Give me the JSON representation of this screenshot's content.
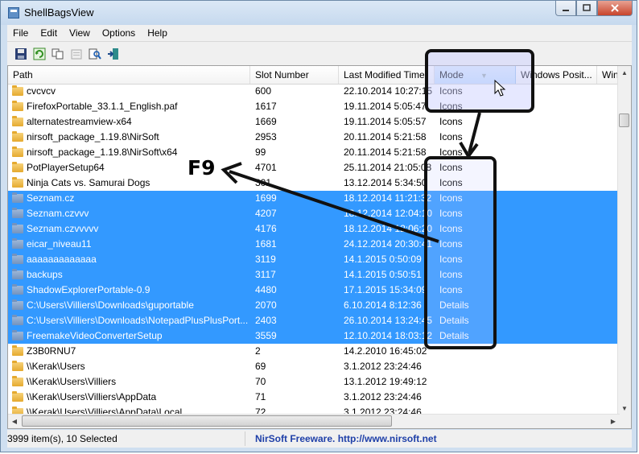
{
  "window": {
    "title": "ShellBagsView"
  },
  "menu": [
    "File",
    "Edit",
    "View",
    "Options",
    "Help"
  ],
  "toolbar": [
    {
      "icon": "save-icon"
    },
    {
      "icon": "refresh-icon"
    },
    {
      "icon": "copy-icon"
    },
    {
      "icon": "properties-icon"
    },
    {
      "icon": "find-icon"
    },
    {
      "icon": "exit-icon"
    }
  ],
  "columns": {
    "path": "Path",
    "slot": "Slot Number",
    "modified": "Last Modified Time",
    "mode": "Mode",
    "winpos": "Windows Posit...",
    "winsize": "Wind"
  },
  "rows": [
    {
      "path": "cvcvcv",
      "slot": "600",
      "time": "22.10.2014 10:27:15",
      "mode": "Icons",
      "sel": false
    },
    {
      "path": "FirefoxPortable_33.1.1_English.paf",
      "slot": "1617",
      "time": "19.11.2014 5:05:47",
      "mode": "Icons",
      "sel": false
    },
    {
      "path": "alternatestreamview-x64",
      "slot": "1669",
      "time": "19.11.2014 5:05:57",
      "mode": "Icons",
      "sel": false
    },
    {
      "path": "nirsoft_package_1.19.8\\NirSoft",
      "slot": "2953",
      "time": "20.11.2014 5:21:58",
      "mode": "Icons",
      "sel": false
    },
    {
      "path": "nirsoft_package_1.19.8\\NirSoft\\x64",
      "slot": "99",
      "time": "20.11.2014 5:21:58",
      "mode": "Icons",
      "sel": false
    },
    {
      "path": "PotPlayerSetup64",
      "slot": "4701",
      "time": "25.11.2014 21:05:08",
      "mode": "Icons",
      "sel": false
    },
    {
      "path": "Ninja Cats vs. Samurai Dogs",
      "slot": "301",
      "time": "13.12.2014 5:34:50",
      "mode": "Icons",
      "sel": false
    },
    {
      "path": "Seznam.cz",
      "slot": "1699",
      "time": "18.12.2014 11:21:32",
      "mode": "Icons",
      "sel": true
    },
    {
      "path": "Seznam.czvvv",
      "slot": "4207",
      "time": "18.12.2014 12:04:10",
      "mode": "Icons",
      "sel": true
    },
    {
      "path": "Seznam.czvvvvv",
      "slot": "4176",
      "time": "18.12.2014 12:06:20",
      "mode": "Icons",
      "sel": true
    },
    {
      "path": "eicar_niveau11",
      "slot": "1681",
      "time": "24.12.2014 20:30:41",
      "mode": "Icons",
      "sel": true
    },
    {
      "path": "aaaaaaaaaaaaa",
      "slot": "3119",
      "time": "14.1.2015 0:50:09",
      "mode": "Icons",
      "sel": true
    },
    {
      "path": "backups",
      "slot": "3117",
      "time": "14.1.2015 0:50:51",
      "mode": "Icons",
      "sel": true
    },
    {
      "path": "ShadowExplorerPortable-0.9",
      "slot": "4480",
      "time": "17.1.2015 15:34:09",
      "mode": "Icons",
      "sel": true
    },
    {
      "path": "C:\\Users\\Villiers\\Downloads\\guportable",
      "slot": "2070",
      "time": "6.10.2014 8:12:36",
      "mode": "Details",
      "sel": true
    },
    {
      "path": "C:\\Users\\Villiers\\Downloads\\NotepadPlusPlusPort...",
      "slot": "2403",
      "time": "26.10.2014 13:24:45",
      "mode": "Details",
      "sel": true
    },
    {
      "path": "FreemakeVideoConverterSetup",
      "slot": "3559",
      "time": "12.10.2014 18:03:12",
      "mode": "Details",
      "sel": true
    },
    {
      "path": "Z3B0RNU7",
      "slot": "2",
      "time": "14.2.2010 16:45:02",
      "mode": "",
      "sel": false
    },
    {
      "path": "\\\\Kerak\\Users",
      "slot": "69",
      "time": "3.1.2012 23:24:46",
      "mode": "",
      "sel": false
    },
    {
      "path": "\\\\Kerak\\Users\\Villiers",
      "slot": "70",
      "time": "13.1.2012 19:49:12",
      "mode": "",
      "sel": false
    },
    {
      "path": "\\\\Kerak\\Users\\Villiers\\AppData",
      "slot": "71",
      "time": "3.1.2012 23:24:46",
      "mode": "",
      "sel": false
    },
    {
      "path": "\\\\Kerak\\Users\\Villiers\\AppData\\Local",
      "slot": "72",
      "time": "3.1.2012 23:24:46",
      "mode": "",
      "sel": false
    }
  ],
  "status": {
    "count": "3999 item(s), 10 Selected",
    "link": "NirSoft Freeware.  http://www.nirsoft.net"
  },
  "annotation": {
    "label": "F9"
  },
  "colors": {
    "selection": "#3399ff",
    "link": "#1e3fa8"
  }
}
